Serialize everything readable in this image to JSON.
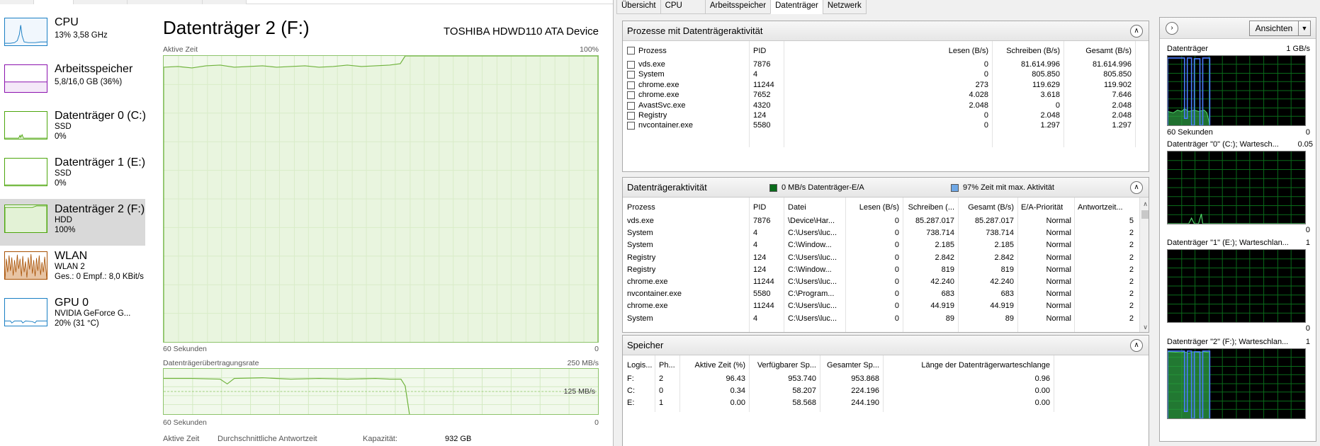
{
  "sidebar": {
    "items": [
      {
        "name": "CPU",
        "sub1": "13% 3,58 GHz",
        "sub2": ""
      },
      {
        "name": "Arbeitsspeicher",
        "sub1": "5,8/16,0 GB (36%)",
        "sub2": ""
      },
      {
        "name": "Datenträger 0 (C:)",
        "sub1": "SSD",
        "sub2": "0%"
      },
      {
        "name": "Datenträger 1 (E:)",
        "sub1": "SSD",
        "sub2": "0%"
      },
      {
        "name": "Datenträger 2 (F:)",
        "sub1": "HDD",
        "sub2": "100%"
      },
      {
        "name": "WLAN",
        "sub1": "WLAN 2",
        "sub2": "Ges.: 0 Empf.: 8,0 KBit/s"
      },
      {
        "name": "GPU 0",
        "sub1": "NVIDIA GeForce G...",
        "sub2": "20% (31 °C)"
      }
    ],
    "colors": {
      "cpu": "#1a7fc4",
      "memory": "#8b12ae",
      "disk": "#4da60c",
      "wlan": "#a74f01",
      "gpu": "#1a7fc4"
    }
  },
  "main": {
    "title": "Datenträger 2 (F:)",
    "device": "TOSHIBA HDWD110 ATA Device",
    "active_label": "Aktive Zeit",
    "active_max": "100%",
    "seconds_label": "60 Sekunden",
    "zero": "0",
    "transfer_label": "Datenträgerübertragungsrate",
    "transfer_max": "250 MB/s",
    "transfer_mid": "125 MB/s",
    "seconds_label2": "60 Sekunden",
    "zero2": "0",
    "stat_active": "Aktive Zeit",
    "stat_response": "Durchschnittliche Antwortzeit",
    "stat_capacity": "Kapazität:",
    "stat_capacity_value": "932 GB"
  },
  "rm": {
    "tabs": [
      "Übersicht",
      "CPU",
      "Arbeitsspeicher",
      "Datenträger",
      "Netzwerk"
    ],
    "active_tab": "Datenträger",
    "processes": {
      "title": "Prozesse mit Datenträgeraktivität",
      "headers": [
        "Prozess",
        "PID",
        "Lesen (B/s)",
        "Schreiben (B/s)",
        "Gesamt (B/s)"
      ],
      "rows": [
        [
          "vds.exe",
          "7876",
          "0",
          "81.614.996",
          "81.614.996"
        ],
        [
          "System",
          "4",
          "0",
          "805.850",
          "805.850"
        ],
        [
          "chrome.exe",
          "11244",
          "273",
          "119.629",
          "119.902"
        ],
        [
          "chrome.exe",
          "7652",
          "4.028",
          "3.618",
          "7.646"
        ],
        [
          "AvastSvc.exe",
          "4320",
          "2.048",
          "0",
          "2.048"
        ],
        [
          "Registry",
          "124",
          "0",
          "2.048",
          "2.048"
        ],
        [
          "nvcontainer.exe",
          "5580",
          "0",
          "1.297",
          "1.297"
        ]
      ]
    },
    "activity": {
      "title": "Datenträgeraktivität",
      "legend1": "0 MB/s Datenträger-E/A",
      "legend1_color": "#0a6b1a",
      "legend2": "97% Zeit mit max. Aktivität",
      "legend2_color": "#6fa8e6",
      "headers": [
        "Prozess",
        "PID",
        "Datei",
        "Lesen (B/s)",
        "Schreiben (...",
        "Gesamt (B/s)",
        "E/A-Priorität",
        "Antwortzeit..."
      ],
      "rows": [
        [
          "vds.exe",
          "7876",
          "\\Device\\Har...",
          "0",
          "85.287.017",
          "85.287.017",
          "Normal",
          "5"
        ],
        [
          "System",
          "4",
          "C:\\Users\\luc...",
          "0",
          "738.714",
          "738.714",
          "Normal",
          "2"
        ],
        [
          "System",
          "4",
          "C:\\Window...",
          "0",
          "2.185",
          "2.185",
          "Normal",
          "2"
        ],
        [
          "Registry",
          "124",
          "C:\\Users\\luc...",
          "0",
          "2.842",
          "2.842",
          "Normal",
          "2"
        ],
        [
          "Registry",
          "124",
          "C:\\Window...",
          "0",
          "819",
          "819",
          "Normal",
          "2"
        ],
        [
          "chrome.exe",
          "11244",
          "C:\\Users\\luc...",
          "0",
          "42.240",
          "42.240",
          "Normal",
          "2"
        ],
        [
          "nvcontainer.exe",
          "5580",
          "C:\\Program...",
          "0",
          "683",
          "683",
          "Normal",
          "2"
        ],
        [
          "chrome.exe",
          "11244",
          "C:\\Users\\luc...",
          "0",
          "44.919",
          "44.919",
          "Normal",
          "2"
        ],
        [
          "System",
          "4",
          "C:\\Users\\luc...",
          "0",
          "89",
          "89",
          "Normal",
          "2"
        ]
      ]
    },
    "storage": {
      "title": "Speicher",
      "headers": [
        "Logis...",
        "Ph...",
        "Aktive Zeit (%)",
        "Verfügbarer Sp...",
        "Gesamter Sp...",
        "Länge der Datenträgerwarteschlange"
      ],
      "rows": [
        [
          "F:",
          "2",
          "96.43",
          "953.740",
          "953.868",
          "0.96"
        ],
        [
          "C:",
          "0",
          "0.34",
          "58.207",
          "224.196",
          "0.00"
        ],
        [
          "E:",
          "1",
          "0.00",
          "58.568",
          "244.190",
          "0.00"
        ]
      ]
    },
    "right_panel": {
      "views_label": "Ansichten",
      "graphs": [
        {
          "title": "Datenträger",
          "value": "1 GB/s",
          "footer_left": "60 Sekunden",
          "footer_right": "0"
        },
        {
          "title": "Datenträger \"0\" (C:); Wartesch...",
          "value": "0.05",
          "footer_left": "",
          "footer_right": "0"
        },
        {
          "title": "Datenträger \"1\" (E:); Warteschlan...",
          "value": "1",
          "footer_left": "",
          "footer_right": "0"
        },
        {
          "title": "Datenträger \"2\" (F:); Warteschlan...",
          "value": "1",
          "footer_left": "",
          "footer_right": ""
        }
      ]
    }
  }
}
